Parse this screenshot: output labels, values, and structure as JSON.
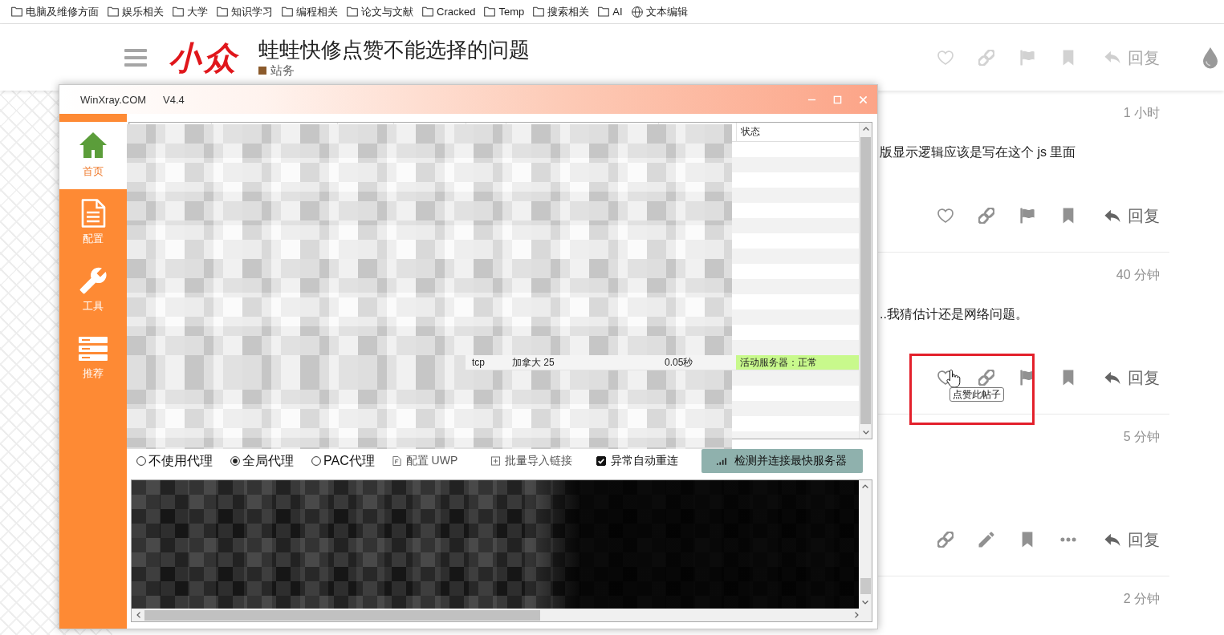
{
  "bookmarks_bar": {
    "items": [
      {
        "kind": "folder",
        "label": "电脑及维修方面"
      },
      {
        "kind": "folder",
        "label": "娱乐相关"
      },
      {
        "kind": "folder",
        "label": "大学"
      },
      {
        "kind": "folder",
        "label": "知识学习"
      },
      {
        "kind": "folder",
        "label": "编程相关"
      },
      {
        "kind": "folder",
        "label": "论文与文献"
      },
      {
        "kind": "folder",
        "label": "Cracked"
      },
      {
        "kind": "folder",
        "label": "Temp"
      },
      {
        "kind": "folder",
        "label": "搜索相关"
      },
      {
        "kind": "folder",
        "label": "AI"
      },
      {
        "kind": "page",
        "label": "文本编辑"
      }
    ]
  },
  "topic_header": {
    "logo": "小众",
    "title": "蛙蛙快修点赞不能选择的问题",
    "category": {
      "name": "站务",
      "color": "#8b5a2b"
    },
    "actions": [
      {
        "kind": "like"
      },
      {
        "kind": "link"
      },
      {
        "kind": "flag"
      },
      {
        "kind": "bookmark"
      },
      {
        "kind": "reply",
        "label": "回复"
      }
    ]
  },
  "posts": [
    {
      "time": "1 小时",
      "text": "版显示逻辑应该是写在这个 js 里面",
      "highlighted": false,
      "actions": [
        {
          "kind": "like",
          "hovered": false
        },
        {
          "kind": "link",
          "hovered": false
        },
        {
          "kind": "flag",
          "hovered": false
        },
        {
          "kind": "bookmark",
          "hovered": false
        },
        {
          "kind": "reply",
          "label": "回复",
          "hovered": false
        }
      ]
    },
    {
      "time": "40 分钟",
      "text": "..我猜估计还是网络问题。",
      "highlighted": true,
      "actions": [
        {
          "kind": "like",
          "hovered": true,
          "tooltip": "点赞此帖子"
        },
        {
          "kind": "link",
          "hovered": false
        },
        {
          "kind": "flag",
          "hovered": false
        },
        {
          "kind": "bookmark",
          "hovered": false
        },
        {
          "kind": "reply",
          "label": "回复",
          "hovered": false
        }
      ]
    },
    {
      "time": "5 分钟",
      "highlighted": false,
      "actions": [
        {
          "kind": "link",
          "hovered": false
        },
        {
          "kind": "edit",
          "hovered": false
        },
        {
          "kind": "bookmark",
          "hovered": false
        },
        {
          "kind": "more",
          "hovered": false
        },
        {
          "kind": "reply",
          "label": "回复",
          "hovered": false
        }
      ]
    },
    {
      "time": "2 分钟",
      "highlighted": false
    }
  ],
  "app_window": {
    "title": "WinXray.COM",
    "version": "V4.4",
    "nav": [
      {
        "kind": "home",
        "label": "首页",
        "selected": true
      },
      {
        "kind": "config",
        "label": "配置",
        "selected": false
      },
      {
        "kind": "tools",
        "label": "工具",
        "selected": false
      },
      {
        "kind": "recommend",
        "label": "推荐",
        "selected": false
      }
    ],
    "server_table": {
      "columns": [
        {
          "label": "状态"
        }
      ],
      "rows": [
        {
          "column_5": "tcp",
          "column_6": "加拿大 25",
          "column_7": "0.05秒",
          "status": "活动服务器：正常",
          "active": true
        }
      ]
    },
    "proxy_modes": [
      {
        "label": "不使用代理",
        "selected": false
      },
      {
        "label": "全局代理",
        "selected": true
      },
      {
        "label": "PAC代理",
        "selected": false
      }
    ],
    "tools": [
      {
        "kind": "file",
        "label": "配置 UWP"
      },
      {
        "kind": "import",
        "label": "批量导入链接"
      }
    ],
    "auto_reconnect": {
      "label": "异常自动重连",
      "checked": true
    },
    "connect_button": {
      "label": "检测并连接最快服务器"
    }
  }
}
